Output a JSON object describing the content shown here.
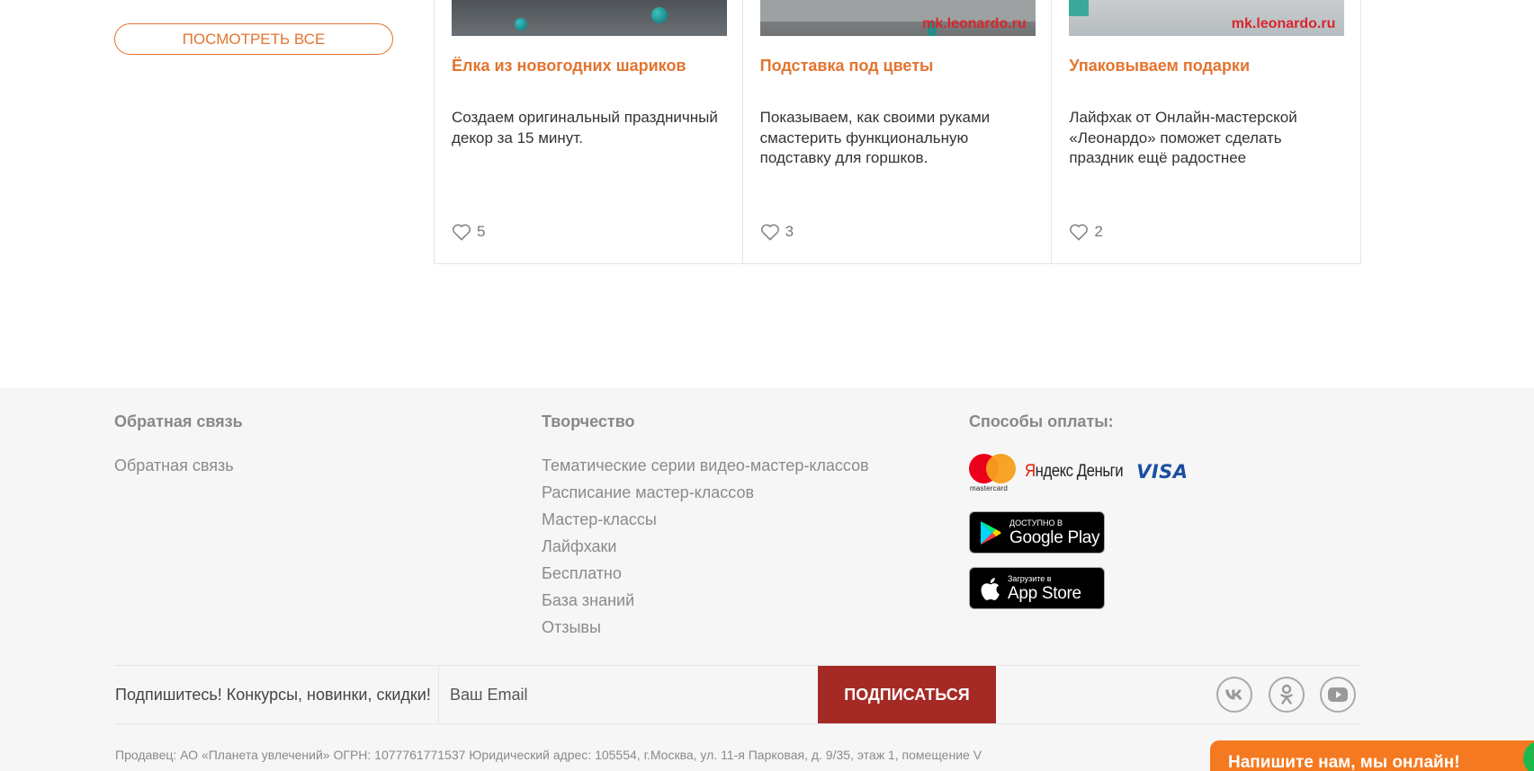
{
  "sidebar": {
    "view_all_label": "ПОСМОТРЕТЬ ВСЕ"
  },
  "cards": [
    {
      "title": "Ёлка из новогодних шариков",
      "description": "Создаем оригинальный праздничный декор за 15 минут.",
      "likes": "5",
      "watermark": ""
    },
    {
      "title": "Подставка под цветы",
      "description": "Показываем, как своими руками смастерить функциональную подставку для горшков.",
      "likes": "3",
      "watermark": "mk.leonardo.ru"
    },
    {
      "title": "Упаковываем подарки",
      "description": "Лайфхак от Онлайн-мастерской «Леонардо» поможет сделать праздник ещё радостнее",
      "likes": "2",
      "watermark": "mk.leonardo.ru"
    }
  ],
  "footer": {
    "feedback": {
      "title": "Обратная связь",
      "links": [
        "Обратная связь"
      ]
    },
    "creative": {
      "title": "Творчество",
      "links": [
        "Тематические серии видео-мастер-классов",
        "Расписание мастер-классов",
        "Мастер-классы",
        "Лайфхаки",
        "Бесплатно",
        "База знаний",
        "Отзывы"
      ]
    },
    "payment": {
      "title": "Способы оплаты:",
      "mastercard_text": "mastercard",
      "yandex_y": "Я",
      "yandex_rest": "ндекс Деньги",
      "visa": "VISA",
      "google_play": {
        "small": "ДОСТУПНО В",
        "big": "Google Play"
      },
      "app_store": {
        "small": "Загрузите в",
        "big": "App Store"
      }
    },
    "subscribe": {
      "text": "Подпишитесь! Конкурсы, новинки, скидки!",
      "email_placeholder": "Ваш Email",
      "button_label": "ПОДПИСАТЬСЯ"
    },
    "social": [
      "vk-icon",
      "odnoklassniki-icon",
      "youtube-icon"
    ],
    "seller": "Продавец: АО «Планета увлечений» ОГРН: 1077761771537 Юридический адрес: 105554, г.Москва, ул. 11-я Парковая, д. 9/35, этаж 1, помещение V"
  },
  "chat": {
    "label": "Напишите нам, мы онлайн!"
  },
  "colors": {
    "accent": "#e3742f",
    "subscribe": "#a52a25",
    "chat": "#f47920",
    "chat_status": "#1fb84f"
  }
}
